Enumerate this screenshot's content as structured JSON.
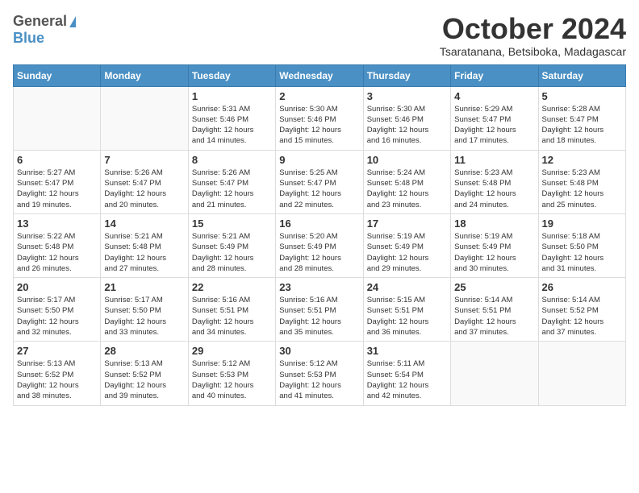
{
  "header": {
    "logo_general": "General",
    "logo_blue": "Blue",
    "month_title": "October 2024",
    "location": "Tsaratanana, Betsiboka, Madagascar"
  },
  "weekdays": [
    "Sunday",
    "Monday",
    "Tuesday",
    "Wednesday",
    "Thursday",
    "Friday",
    "Saturday"
  ],
  "days": [
    {
      "date": null,
      "sunrise": null,
      "sunset": null,
      "daylight": null
    },
    {
      "date": null,
      "sunrise": null,
      "sunset": null,
      "daylight": null
    },
    {
      "date": "1",
      "sunrise": "5:31 AM",
      "sunset": "5:46 PM",
      "daylight": "12 hours and 14 minutes."
    },
    {
      "date": "2",
      "sunrise": "5:30 AM",
      "sunset": "5:46 PM",
      "daylight": "12 hours and 15 minutes."
    },
    {
      "date": "3",
      "sunrise": "5:30 AM",
      "sunset": "5:46 PM",
      "daylight": "12 hours and 16 minutes."
    },
    {
      "date": "4",
      "sunrise": "5:29 AM",
      "sunset": "5:47 PM",
      "daylight": "12 hours and 17 minutes."
    },
    {
      "date": "5",
      "sunrise": "5:28 AM",
      "sunset": "5:47 PM",
      "daylight": "12 hours and 18 minutes."
    },
    {
      "date": "6",
      "sunrise": "5:27 AM",
      "sunset": "5:47 PM",
      "daylight": "12 hours and 19 minutes."
    },
    {
      "date": "7",
      "sunrise": "5:26 AM",
      "sunset": "5:47 PM",
      "daylight": "12 hours and 20 minutes."
    },
    {
      "date": "8",
      "sunrise": "5:26 AM",
      "sunset": "5:47 PM",
      "daylight": "12 hours and 21 minutes."
    },
    {
      "date": "9",
      "sunrise": "5:25 AM",
      "sunset": "5:47 PM",
      "daylight": "12 hours and 22 minutes."
    },
    {
      "date": "10",
      "sunrise": "5:24 AM",
      "sunset": "5:48 PM",
      "daylight": "12 hours and 23 minutes."
    },
    {
      "date": "11",
      "sunrise": "5:23 AM",
      "sunset": "5:48 PM",
      "daylight": "12 hours and 24 minutes."
    },
    {
      "date": "12",
      "sunrise": "5:23 AM",
      "sunset": "5:48 PM",
      "daylight": "12 hours and 25 minutes."
    },
    {
      "date": "13",
      "sunrise": "5:22 AM",
      "sunset": "5:48 PM",
      "daylight": "12 hours and 26 minutes."
    },
    {
      "date": "14",
      "sunrise": "5:21 AM",
      "sunset": "5:48 PM",
      "daylight": "12 hours and 27 minutes."
    },
    {
      "date": "15",
      "sunrise": "5:21 AM",
      "sunset": "5:49 PM",
      "daylight": "12 hours and 28 minutes."
    },
    {
      "date": "16",
      "sunrise": "5:20 AM",
      "sunset": "5:49 PM",
      "daylight": "12 hours and 28 minutes."
    },
    {
      "date": "17",
      "sunrise": "5:19 AM",
      "sunset": "5:49 PM",
      "daylight": "12 hours and 29 minutes."
    },
    {
      "date": "18",
      "sunrise": "5:19 AM",
      "sunset": "5:49 PM",
      "daylight": "12 hours and 30 minutes."
    },
    {
      "date": "19",
      "sunrise": "5:18 AM",
      "sunset": "5:50 PM",
      "daylight": "12 hours and 31 minutes."
    },
    {
      "date": "20",
      "sunrise": "5:17 AM",
      "sunset": "5:50 PM",
      "daylight": "12 hours and 32 minutes."
    },
    {
      "date": "21",
      "sunrise": "5:17 AM",
      "sunset": "5:50 PM",
      "daylight": "12 hours and 33 minutes."
    },
    {
      "date": "22",
      "sunrise": "5:16 AM",
      "sunset": "5:51 PM",
      "daylight": "12 hours and 34 minutes."
    },
    {
      "date": "23",
      "sunrise": "5:16 AM",
      "sunset": "5:51 PM",
      "daylight": "12 hours and 35 minutes."
    },
    {
      "date": "24",
      "sunrise": "5:15 AM",
      "sunset": "5:51 PM",
      "daylight": "12 hours and 36 minutes."
    },
    {
      "date": "25",
      "sunrise": "5:14 AM",
      "sunset": "5:51 PM",
      "daylight": "12 hours and 37 minutes."
    },
    {
      "date": "26",
      "sunrise": "5:14 AM",
      "sunset": "5:52 PM",
      "daylight": "12 hours and 37 minutes."
    },
    {
      "date": "27",
      "sunrise": "5:13 AM",
      "sunset": "5:52 PM",
      "daylight": "12 hours and 38 minutes."
    },
    {
      "date": "28",
      "sunrise": "5:13 AM",
      "sunset": "5:52 PM",
      "daylight": "12 hours and 39 minutes."
    },
    {
      "date": "29",
      "sunrise": "5:12 AM",
      "sunset": "5:53 PM",
      "daylight": "12 hours and 40 minutes."
    },
    {
      "date": "30",
      "sunrise": "5:12 AM",
      "sunset": "5:53 PM",
      "daylight": "12 hours and 41 minutes."
    },
    {
      "date": "31",
      "sunrise": "5:11 AM",
      "sunset": "5:54 PM",
      "daylight": "12 hours and 42 minutes."
    },
    {
      "date": null,
      "sunrise": null,
      "sunset": null,
      "daylight": null
    },
    {
      "date": null,
      "sunrise": null,
      "sunset": null,
      "daylight": null
    }
  ],
  "labels": {
    "sunrise": "Sunrise: ",
    "sunset": "Sunset: ",
    "daylight": "Daylight: "
  }
}
